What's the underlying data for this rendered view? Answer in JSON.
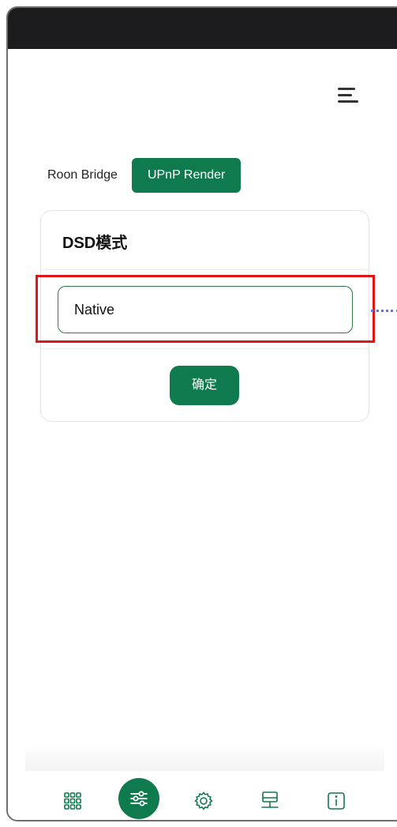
{
  "tabs": [
    {
      "label": "Roon Bridge",
      "active": false
    },
    {
      "label": "UPnP Render",
      "active": true
    }
  ],
  "card": {
    "title": "DSD模式",
    "select_value": "Native",
    "confirm_label": "确定"
  },
  "bottom_nav": [
    {
      "icon": "grid-icon",
      "active": false
    },
    {
      "icon": "sliders-icon",
      "active": true
    },
    {
      "icon": "gear-icon",
      "active": false
    },
    {
      "icon": "network-icon",
      "active": false
    },
    {
      "icon": "info-icon",
      "active": false
    }
  ],
  "colors": {
    "accent": "#0f7a4e",
    "highlight": "#e01616",
    "connector": "#6a74d4",
    "status_bar": "#1c1c1e"
  }
}
